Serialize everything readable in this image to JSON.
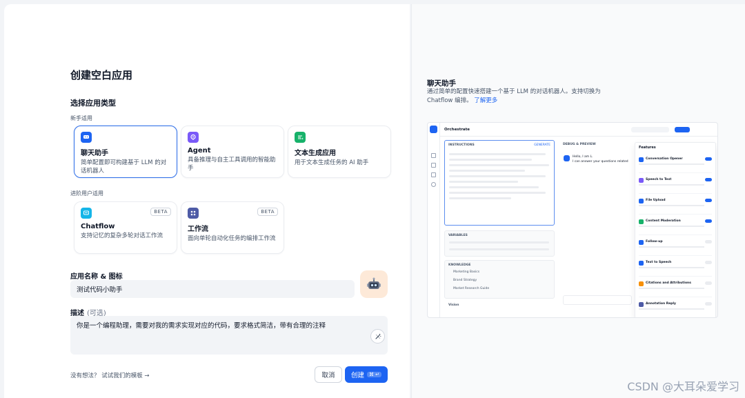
{
  "dialog": {
    "title": "创建空白应用",
    "type_section": "选择应用类型",
    "beginner_label": "新手适用",
    "advanced_label": "进阶用户适用",
    "beginner_cards": [
      {
        "title": "聊天助手",
        "desc": "简单配置即可构建基于 LLM 的对话机器人",
        "icon": "chat-bubble-icon",
        "color": "#1d64f2",
        "selected": true
      },
      {
        "title": "Agent",
        "desc": "具备推理与自主工具调用的智能助手",
        "icon": "agent-icon",
        "color": "#7a5af8"
      },
      {
        "title": "文本生成应用",
        "desc": "用于文本生成任务的 AI 助手",
        "icon": "text-generator-icon",
        "color": "#17b26a"
      }
    ],
    "advanced_cards": [
      {
        "title": "Chatflow",
        "desc": "支持记忆的复杂多轮对话工作流",
        "badge": "BETA",
        "icon": "chatflow-icon",
        "color": "#15b5e8"
      },
      {
        "title": "工作流",
        "desc": "面向单轮自动化任务的编排工作流",
        "badge": "BETA",
        "icon": "workflow-icon",
        "color": "#4e5ba6"
      }
    ],
    "name_label": "应用名称 & 图标",
    "name_value": "测试代码小助手",
    "desc_label": "描述",
    "desc_optional": "(可选)",
    "desc_value": "你是一个编程助理，需要对我的需求实现对应的代码，要求格式简洁，带有合理的注释",
    "hint": "没有想法？ 试试我们的模板",
    "hint_arrow": "→",
    "cancel_label": "取消",
    "create_label": "创建",
    "create_shortcut": "⌘ ↵"
  },
  "preview": {
    "title": "聊天助手",
    "desc": "通过简单的配置快速搭建一个基于 LLM 的对话机器人。支持切换为 Chatflow 编排。",
    "learn_more": "了解更多",
    "screenshot": {
      "header": "Orchestrate",
      "instructions": "INSTRUCTIONS",
      "generate": "GENERATE",
      "debug": "DEBUG & PREVIEW",
      "greeting": "Hello, I am L.",
      "greeting2": "I can answer your questions related",
      "variables": "VARIABLES",
      "knowledge": "KNOWLEDGE",
      "kb_items": [
        "Marketing Basics",
        "Brand Strategy",
        "Market Research Guide"
      ],
      "vision": "Vision",
      "features_title": "Features",
      "features": [
        "Conversation Opener",
        "Speech to Text",
        "File Upload",
        "Content Moderation",
        "Follow-up",
        "Text to Speech",
        "Citations and Attributions",
        "Annotation Reply"
      ],
      "features_on": [
        true,
        true,
        true,
        true,
        false,
        false,
        false,
        false
      ]
    }
  },
  "watermark": "CSDN @大耳朵爱学习"
}
